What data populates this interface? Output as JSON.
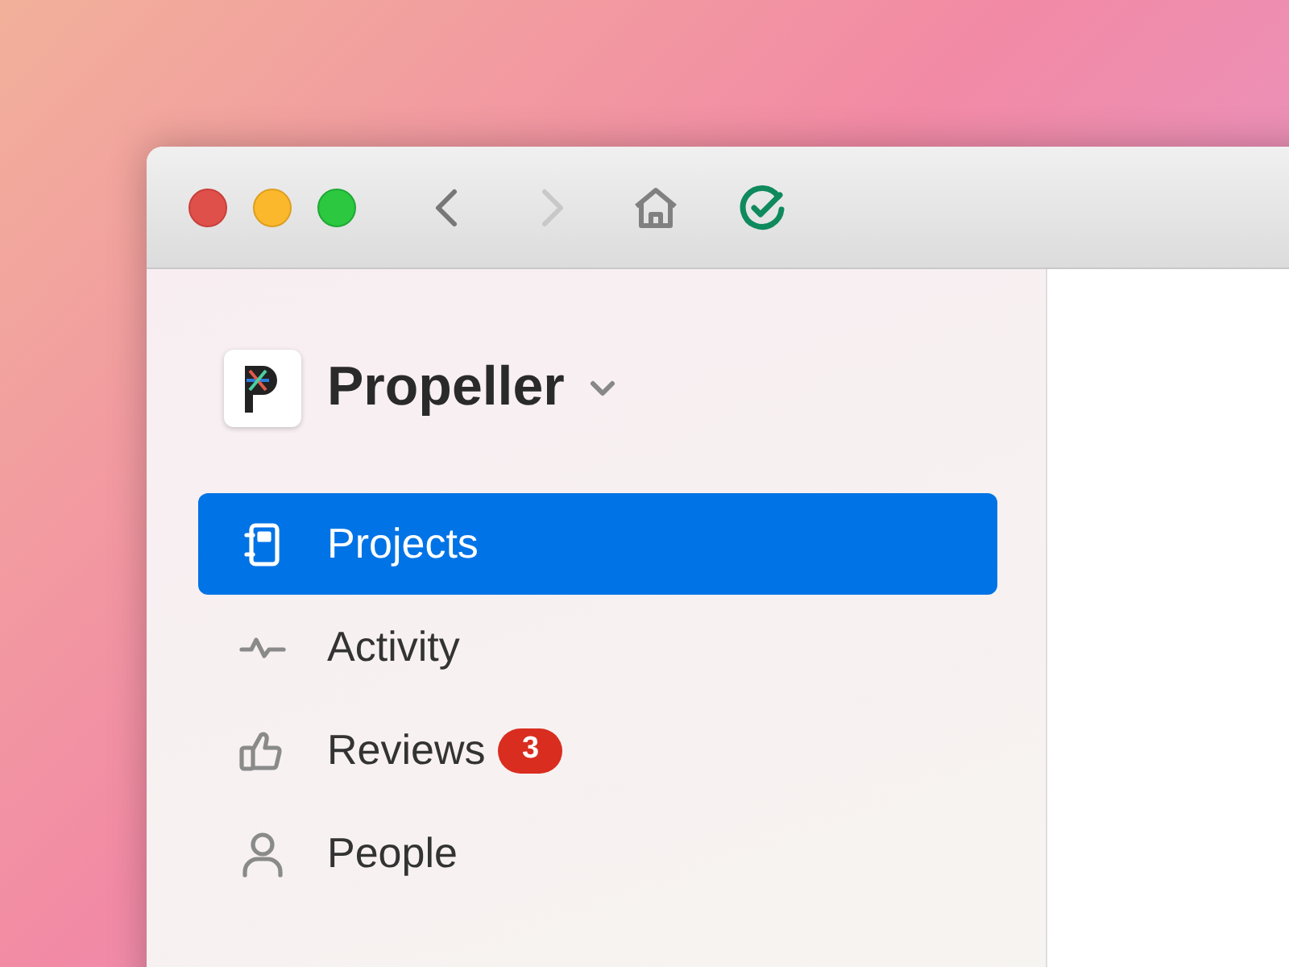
{
  "toolbar": {
    "back": {
      "disabled": false
    },
    "forward": {
      "disabled": true
    }
  },
  "workspace": {
    "name": "Propeller"
  },
  "nav": [
    {
      "kind": "projects",
      "label": "Projects",
      "selected": true
    },
    {
      "kind": "activity",
      "label": "Activity",
      "selected": false
    },
    {
      "kind": "reviews",
      "label": "Reviews",
      "selected": false,
      "badge": "3"
    },
    {
      "kind": "people",
      "label": "People",
      "selected": false
    }
  ]
}
